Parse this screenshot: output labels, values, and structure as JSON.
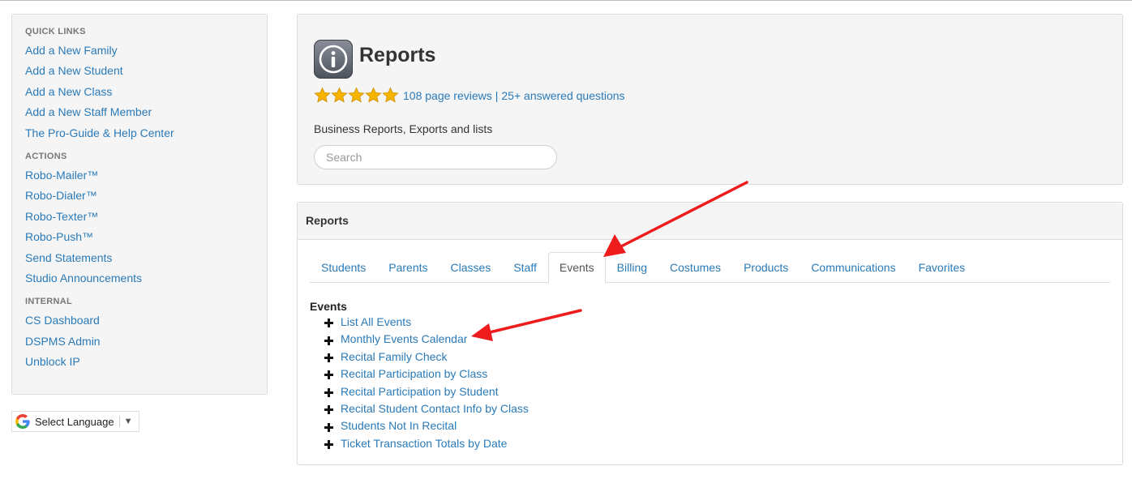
{
  "sidebar": {
    "sections": [
      {
        "heading": "QUICK LINKS",
        "items": [
          "Add a New Family",
          "Add a New Student",
          "Add a New Class",
          "Add a New Staff Member",
          "The Pro-Guide & Help Center"
        ]
      },
      {
        "heading": "ACTIONS",
        "items": [
          "Robo-Mailer™",
          "Robo-Dialer™",
          "Robo-Texter™",
          "Robo-Push™",
          "Send Statements",
          "Studio Announcements"
        ]
      },
      {
        "heading": "INTERNAL",
        "items": [
          "CS Dashboard",
          "DSPMS Admin",
          "Unblock IP"
        ]
      }
    ],
    "language": {
      "label": "Select Language",
      "icon": "google-icon",
      "dropdown_icon": "triangle-down-icon"
    }
  },
  "header": {
    "icon": "info-icon",
    "title": "Reports",
    "rating": {
      "stars": 5,
      "reviews_link": "108 page reviews",
      "separator": "|",
      "questions_link": "25+ answered questions"
    },
    "subtitle": "Business Reports, Exports and lists",
    "search": {
      "placeholder": "Search",
      "value": ""
    }
  },
  "reports": {
    "panel_title": "Reports",
    "tabs": [
      {
        "label": "Students",
        "active": false
      },
      {
        "label": "Parents",
        "active": false
      },
      {
        "label": "Classes",
        "active": false
      },
      {
        "label": "Staff",
        "active": false
      },
      {
        "label": "Events",
        "active": true
      },
      {
        "label": "Billing",
        "active": false
      },
      {
        "label": "Costumes",
        "active": false
      },
      {
        "label": "Products",
        "active": false
      },
      {
        "label": "Communications",
        "active": false
      },
      {
        "label": "Favorites",
        "active": false
      }
    ],
    "section_title": "Events",
    "items": [
      "List All Events",
      "Monthly Events Calendar",
      "Recital Family Check",
      "Recital Participation by Class",
      "Recital Participation by Student",
      "Recital Student Contact Info by Class",
      "Students Not In Recital",
      "Ticket Transaction Totals by Date"
    ]
  },
  "colors": {
    "link": "#2a7ab8",
    "panel_bg": "#f5f5f5",
    "star": "#f5b400",
    "annotation_arrow": "#ee1c1c"
  }
}
